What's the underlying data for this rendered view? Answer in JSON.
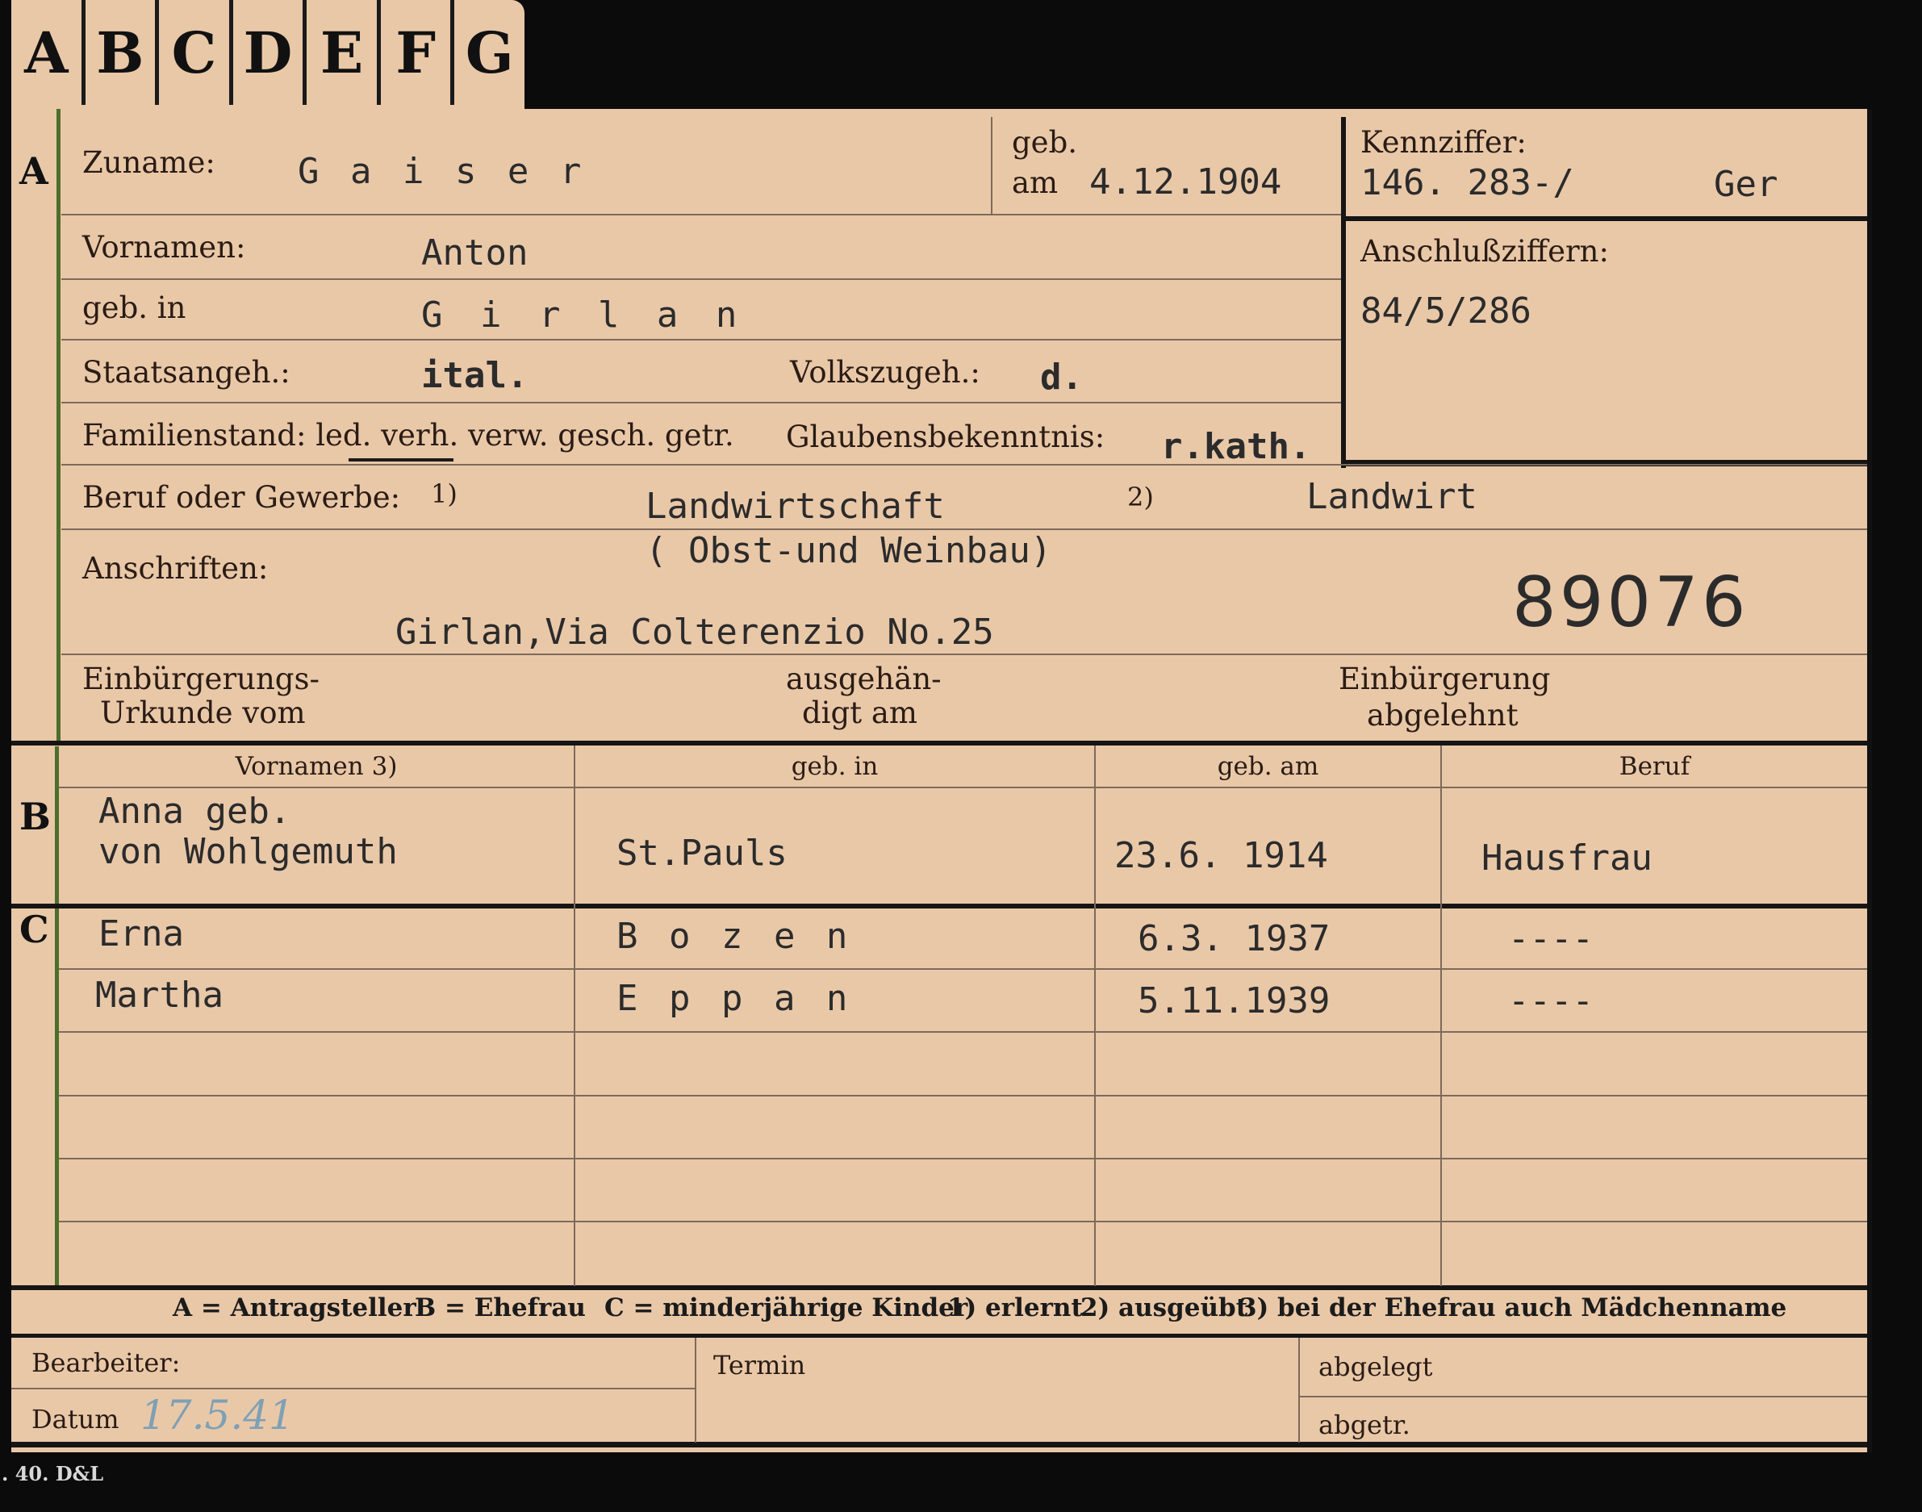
{
  "tabs": [
    "A",
    "B",
    "C",
    "D",
    "E",
    "F",
    "G"
  ],
  "sections": {
    "a": "A",
    "b": "B",
    "c": "C"
  },
  "applicant": {
    "zuname_label": "Zuname:",
    "zuname": "G a i s e r",
    "geb_label": "geb.",
    "am_label": "am",
    "geb_am": "4.12.1904",
    "vornamen_label": "Vornamen:",
    "vornamen": "Anton",
    "geb_in_label": "geb. in",
    "geb_in": "G i r l a n",
    "staatsangeh_label": "Staatsangeh.:",
    "staatsangeh": "ital.",
    "volkszugeh_label": "Volkszugeh.:",
    "volkszugeh": "d.",
    "familienstand_label": "Familienstand: led. verh. verw. gesch. getr.",
    "glaubensbekenntnis_label": "Glaubensbekenntnis:",
    "glaubensbekenntnis": "r.kath.",
    "beruf_label": "Beruf oder Gewerbe:",
    "beruf_note1": "1)",
    "beruf_erlernt": "Landwirtschaft",
    "beruf_note2": "2)",
    "beruf_ausgeuebt": "Landwirt",
    "anschriften_label": "Anschriften:",
    "beruf_detail": "( Obst-und Weinbau)",
    "anschrift": "Girlan,Via Colterenzio No.25",
    "stamp_number": "89076",
    "einbuergerungs_label1": "Einbürgerungs-",
    "einbuergerungs_label2": "Urkunde vom",
    "ausgehaendigt_label1": "ausgehän-",
    "ausgehaendigt_label2": "digt am",
    "einbuergerung_abgelehnt1": "Einbürgerung",
    "einbuergerung_abgelehnt2": "abgelehnt"
  },
  "kennziffer": {
    "label": "Kennziffer:",
    "value": "146. 283-/",
    "suffix": "Ger",
    "anschluss_label": "Anschlußziffern:",
    "anschluss_value": "84/5/286"
  },
  "table": {
    "headers": [
      "Vornamen 3)",
      "geb. in",
      "geb. am",
      "Beruf"
    ],
    "spouse": {
      "vornamen_line1": "Anna geb.",
      "vornamen_line2": "von Wohlgemuth",
      "geb_in": "St.Pauls",
      "geb_am": "23.6. 1914",
      "beruf": "Hausfrau"
    },
    "children": [
      {
        "vornamen": "Erna",
        "geb_in": "B o z e n",
        "geb_am": "6.3. 1937",
        "beruf": "----"
      },
      {
        "vornamen": "Martha",
        "geb_in": "E p p a n",
        "geb_am": "5.11.1939",
        "beruf": "----"
      }
    ]
  },
  "legend": {
    "a": "A = Antragsteller",
    "b": "B = Ehefrau",
    "c": "C = minderjährige Kinder",
    "n1": "1) erlernt",
    "n2": "2) ausgeübt",
    "n3": "3) bei der Ehefrau auch Mädchenname"
  },
  "footer": {
    "bearbeiter_label": "Bearbeiter:",
    "datum_label": "Datum",
    "datum_value": "17.5.41",
    "termin_label": "Termin",
    "abgelegt_label": "abgelegt",
    "abgetr_label": "abgetr.",
    "print_code": ". 40. D&L"
  }
}
